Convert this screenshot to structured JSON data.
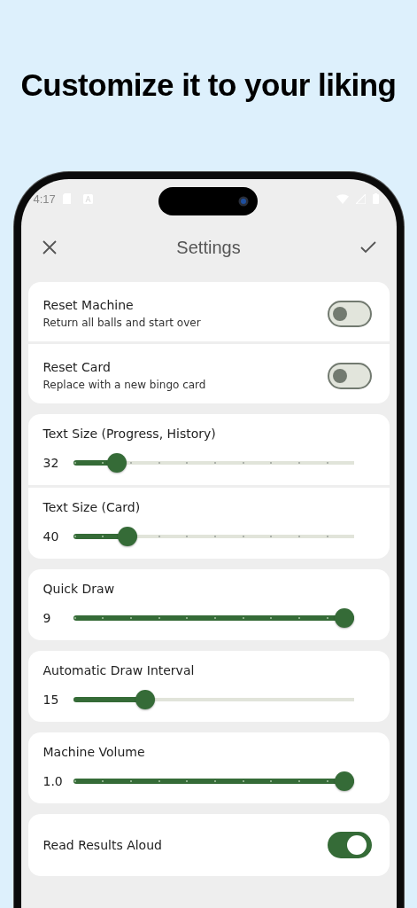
{
  "headline": "Customize it to your liking",
  "status_bar": {
    "time": "4:17"
  },
  "app_bar": {
    "title": "Settings"
  },
  "groups": [
    {
      "items": [
        {
          "kind": "switch",
          "title": "Reset Machine",
          "subtitle": "Return all balls and start over",
          "on": false
        },
        {
          "kind": "switch",
          "title": "Reset Card",
          "subtitle": "Replace with a new bingo card",
          "on": false
        }
      ]
    },
    {
      "items": [
        {
          "kind": "stepped-slider",
          "title": "Text Size (Progress, History)",
          "value": "32",
          "level": 0.13
        },
        {
          "kind": "stepped-slider",
          "title": "Text Size (Card)",
          "value": "40",
          "level": 0.17
        }
      ]
    },
    {
      "items": [
        {
          "kind": "stepped-slider",
          "title": "Quick Draw",
          "value": "9",
          "level": 1
        }
      ]
    },
    {
      "items": [
        {
          "kind": "slider",
          "title": "Automatic Draw Interval",
          "value": "15",
          "level": 0.24
        }
      ]
    },
    {
      "items": [
        {
          "kind": "stepped-slider",
          "title": "Machine Volume",
          "value": "1.0",
          "level": 1
        }
      ]
    },
    {
      "items": [
        {
          "kind": "switch",
          "title": "Read Results Aloud",
          "on": true
        }
      ]
    }
  ]
}
